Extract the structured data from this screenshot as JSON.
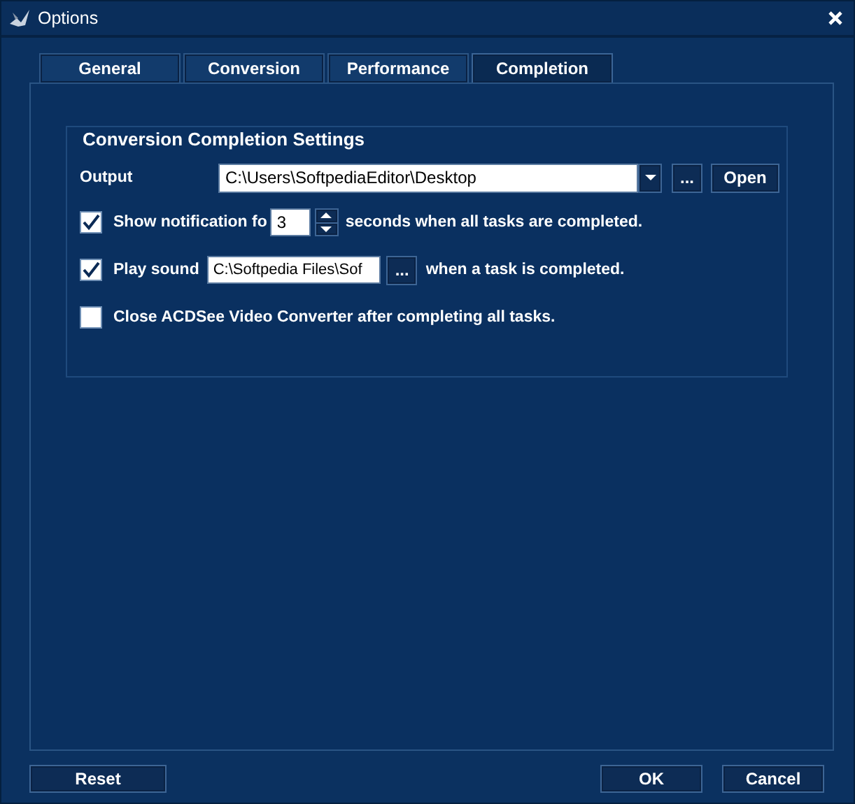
{
  "window": {
    "title": "Options"
  },
  "tabs": [
    {
      "label": "General",
      "selected": false
    },
    {
      "label": "Conversion",
      "selected": false
    },
    {
      "label": "Performance",
      "selected": false
    },
    {
      "label": "Completion",
      "selected": true
    }
  ],
  "group": {
    "title": "Conversion Completion Settings",
    "output": {
      "label": "Output",
      "value": "C:\\Users\\SoftpediaEditor\\Desktop",
      "browse": "...",
      "open": "Open"
    },
    "options": [
      {
        "kind": "spin",
        "checked": true,
        "label": "Show notification fo",
        "value": "3",
        "suffix": "seconds when all tasks are completed."
      },
      {
        "kind": "file",
        "checked": true,
        "label": "Play sound",
        "value": "C:\\Softpedia Files\\Sof",
        "browse": "...",
        "suffix": "when a task is completed."
      },
      {
        "kind": "plain",
        "checked": false,
        "label": "Close ACDSee Video Converter after completing all tasks."
      }
    ]
  },
  "footer": {
    "left": [
      "Reset"
    ],
    "right": [
      "OK",
      "Cancel"
    ]
  }
}
